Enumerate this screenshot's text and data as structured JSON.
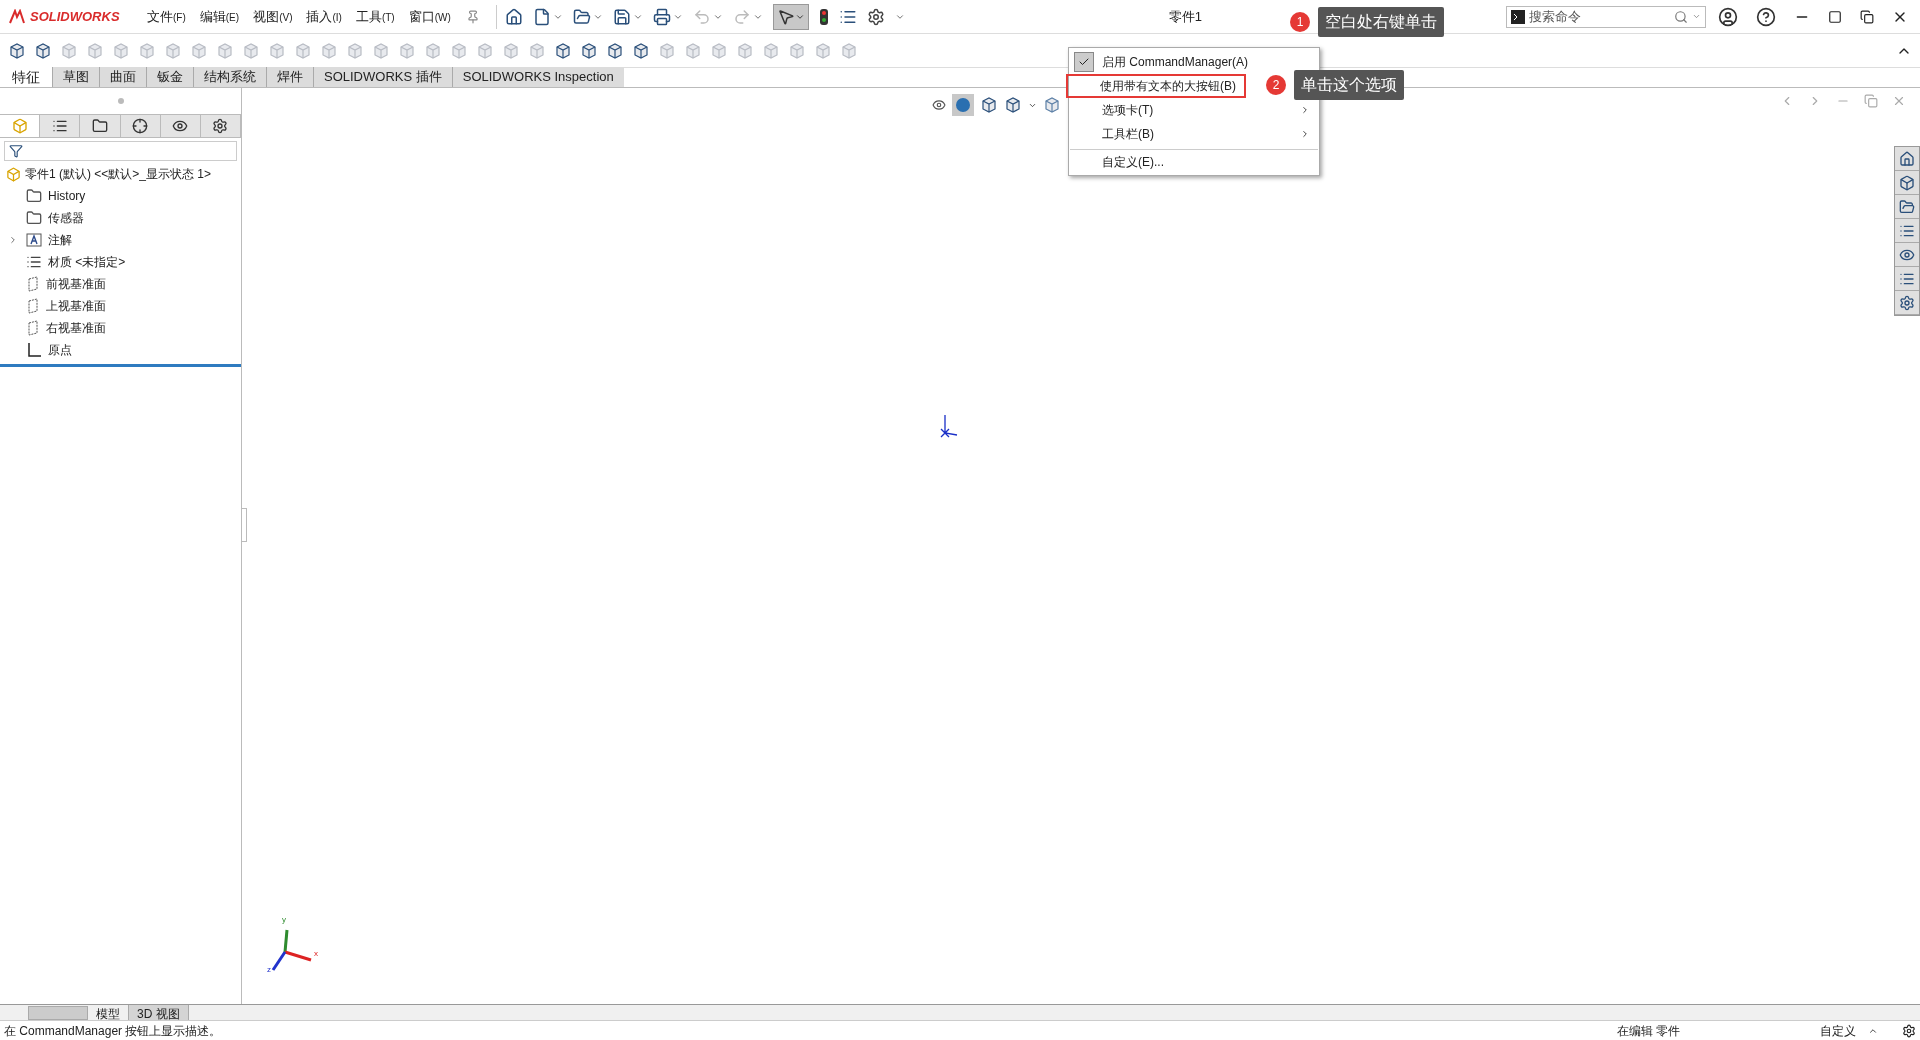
{
  "app": {
    "logo": "SOLIDWORKS"
  },
  "menu": [
    {
      "label": "文件",
      "key": "(F)"
    },
    {
      "label": "编辑",
      "key": "(E)"
    },
    {
      "label": "视图",
      "key": "(V)"
    },
    {
      "label": "插入",
      "key": "(I)"
    },
    {
      "label": "工具",
      "key": "(T)"
    },
    {
      "label": "窗口",
      "key": "(W)"
    }
  ],
  "title": "零件1",
  "search": {
    "placeholder": "搜索命令"
  },
  "command_tabs": [
    {
      "label": "特征",
      "selected": true
    },
    {
      "label": "草图",
      "selected": false
    },
    {
      "label": "曲面",
      "selected": false
    },
    {
      "label": "钣金",
      "selected": false
    },
    {
      "label": "结构系统",
      "selected": false
    },
    {
      "label": "焊件",
      "selected": false
    },
    {
      "label": "SOLIDWORKS 插件",
      "selected": false
    },
    {
      "label": "SOLIDWORKS Inspection",
      "selected": false
    }
  ],
  "panel_tabs": [
    {
      "selected": true
    },
    {
      "selected": false
    },
    {
      "selected": false
    },
    {
      "selected": false
    },
    {
      "selected": false
    },
    {
      "selected": false
    }
  ],
  "tree": {
    "label": "零件1 (默认) <<默认>_显示状态 1>",
    "children": [
      {
        "label": "History",
        "kind": "history"
      },
      {
        "label": "传感器",
        "kind": "sensor"
      },
      {
        "label": "注解",
        "kind": "annotation",
        "expanded": false
      },
      {
        "label": "材质 <未指定>",
        "kind": "material"
      },
      {
        "label": "前视基准面",
        "kind": "plane"
      },
      {
        "label": "上视基准面",
        "kind": "plane"
      },
      {
        "label": "右视基准面",
        "kind": "plane"
      },
      {
        "label": "原点",
        "kind": "origin"
      }
    ]
  },
  "context_menu": [
    {
      "label": "启用 CommandManager(A)",
      "checked": true,
      "submenu": false,
      "outlined": false,
      "separator_before": false
    },
    {
      "label": "使用带有文本的大按钮(B)",
      "checked": false,
      "submenu": false,
      "outlined": true,
      "separator_before": false
    },
    {
      "label": "选项卡(T)",
      "checked": false,
      "submenu": true,
      "outlined": false,
      "separator_before": false
    },
    {
      "label": "工具栏(B)",
      "checked": false,
      "submenu": true,
      "outlined": false,
      "separator_before": false
    },
    {
      "label": "自定义(E)...",
      "checked": false,
      "submenu": false,
      "outlined": false,
      "separator_before": true
    }
  ],
  "callouts": [
    {
      "number": "1",
      "text": "空白处右键单击"
    },
    {
      "number": "2",
      "text": "单击这个选项"
    }
  ],
  "triad": {
    "y": "y",
    "x": "x",
    "z": "z"
  },
  "bottom_tabs": [
    {
      "label": "模型",
      "selected": true
    },
    {
      "label": "3D 视图",
      "selected": false
    }
  ],
  "status_bar": {
    "message": "在 CommandManager 按钮上显示描述。",
    "mode": "在编辑 零件",
    "units": "自定义"
  }
}
